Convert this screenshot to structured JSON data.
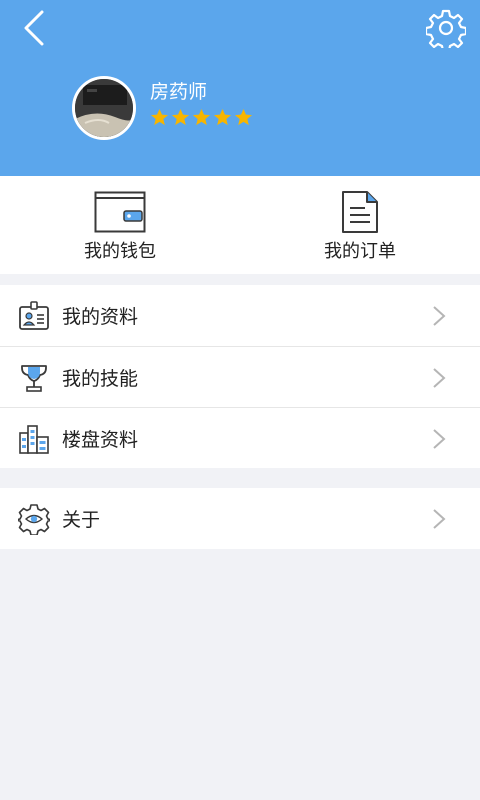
{
  "header": {
    "back_icon": "back-arrow-icon",
    "settings_icon": "gear-icon",
    "username": "房药师",
    "rating": 5,
    "rating_max": 5,
    "background_color": "#5ba6ec",
    "star_color": "#f7b500"
  },
  "quick_actions": [
    {
      "label": "我的钱包",
      "icon": "wallet-icon"
    },
    {
      "label": "我的订单",
      "icon": "document-icon"
    }
  ],
  "menu": {
    "group1": [
      {
        "label": "我的资料",
        "icon": "id-badge-icon"
      },
      {
        "label": "我的技能",
        "icon": "trophy-icon"
      },
      {
        "label": "楼盘资料",
        "icon": "buildings-icon"
      }
    ],
    "group2": [
      {
        "label": "关于",
        "icon": "gear-eye-icon"
      }
    ]
  },
  "colors": {
    "accent": "#5ba6ec",
    "page_background": "#f1f2f6",
    "chevron": "#b5b5b5"
  }
}
